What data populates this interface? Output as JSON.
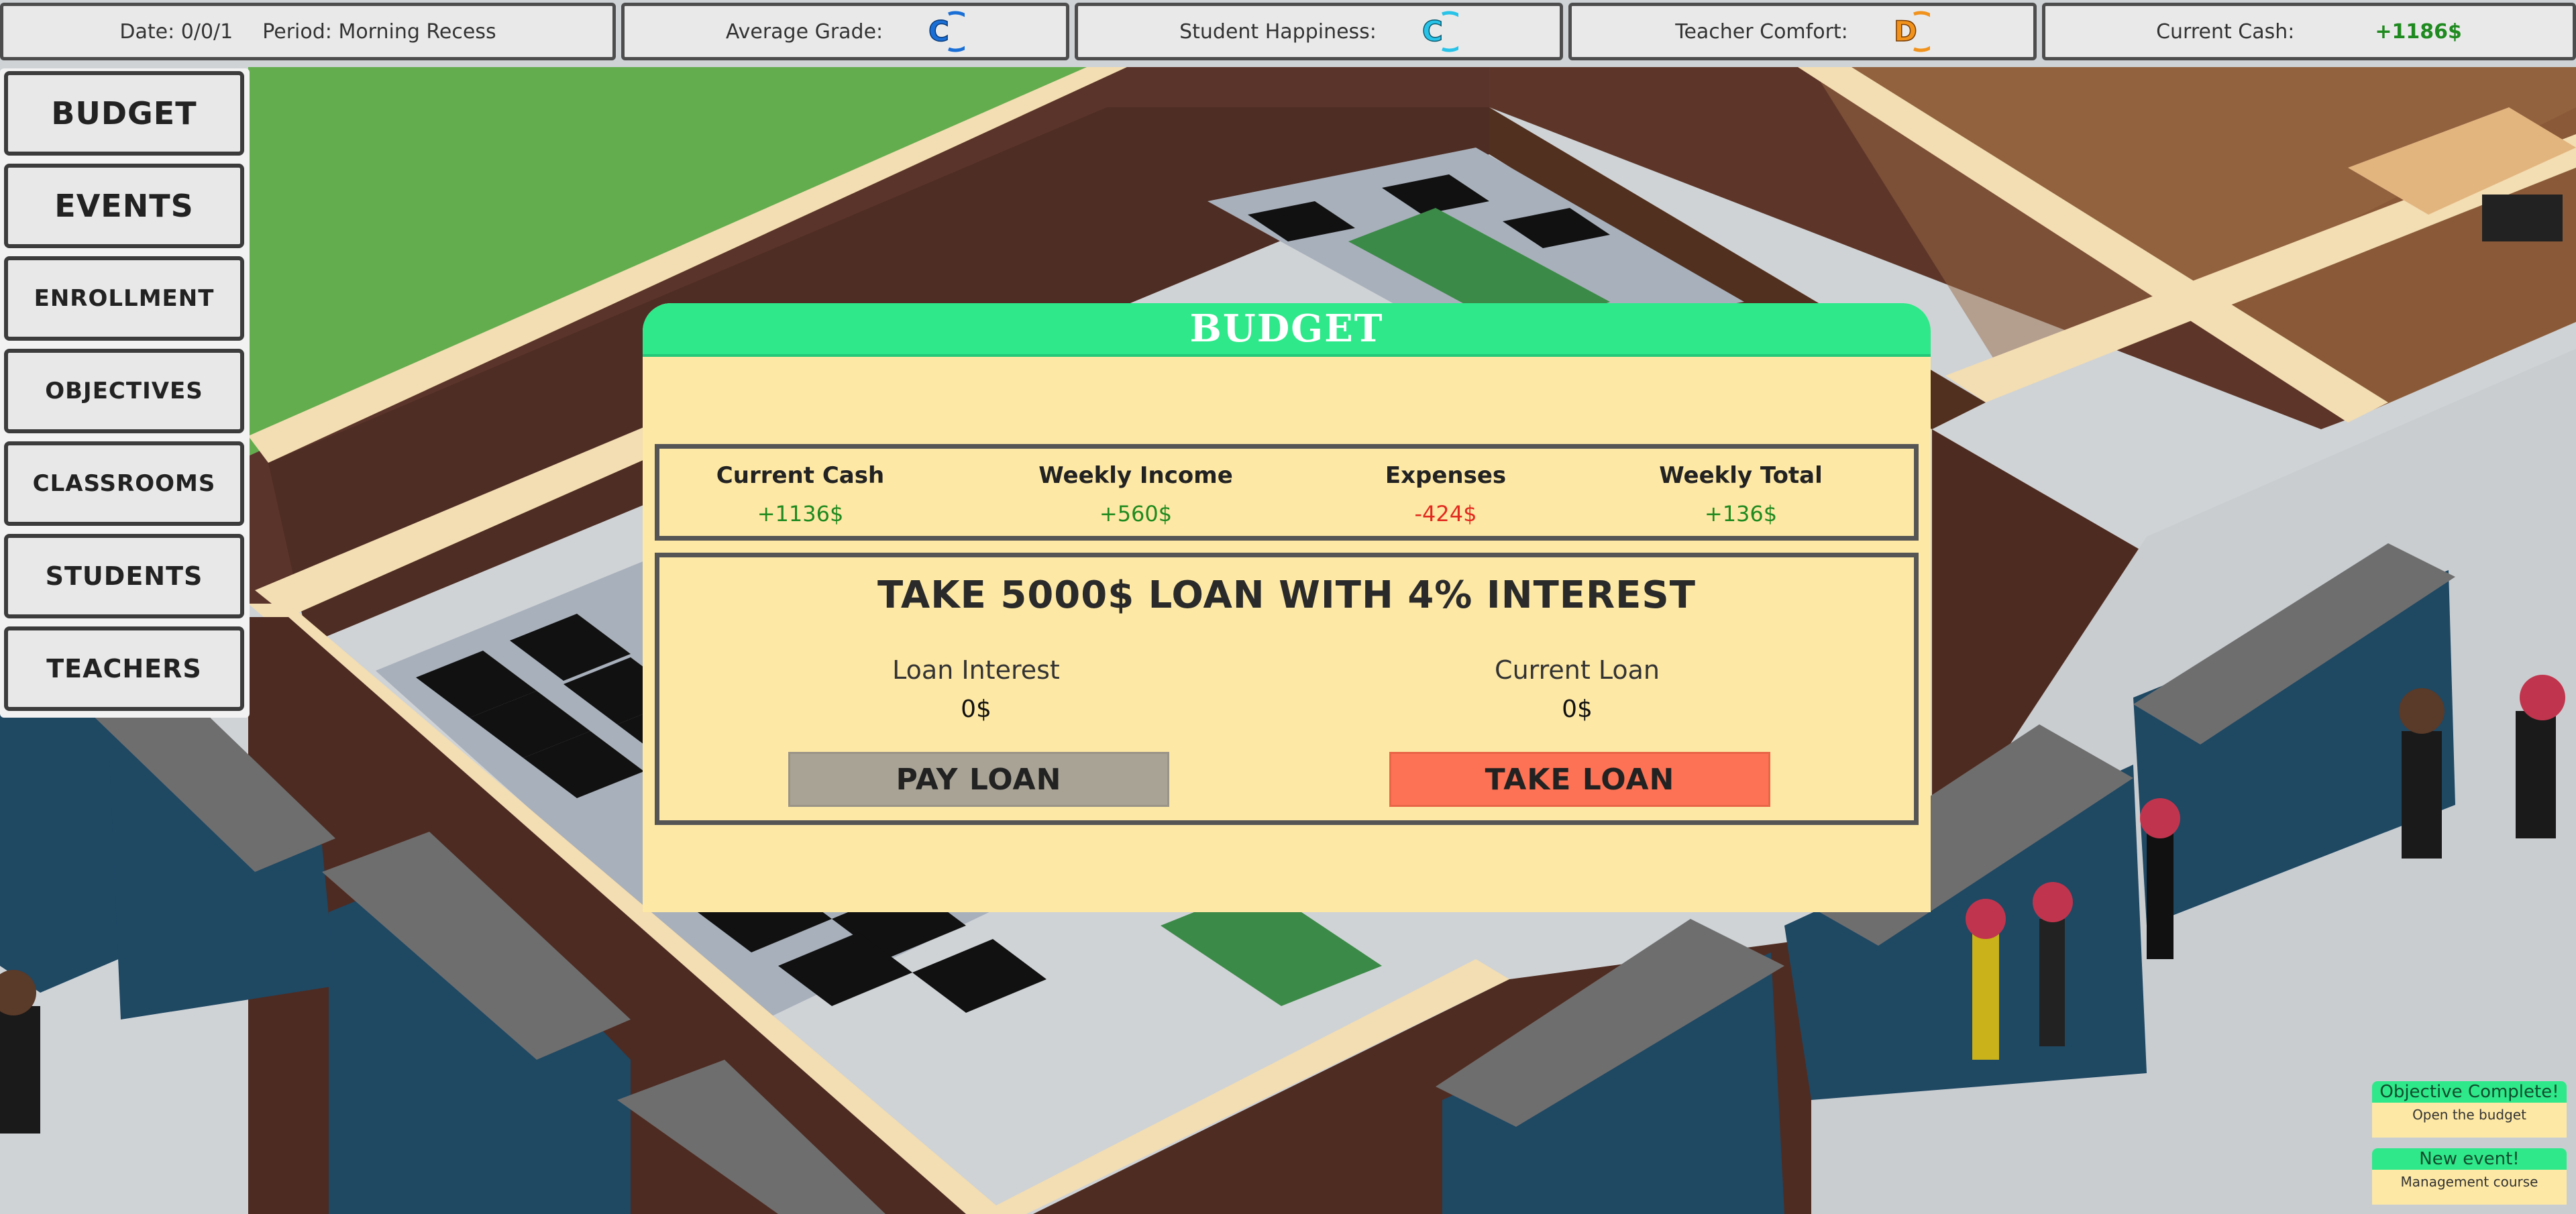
{
  "hud": {
    "date_label": "Date:",
    "date_value": "0/0/1",
    "period_label": "Period:",
    "period_value": "Morning Recess",
    "avg_grade_label": "Average Grade:",
    "avg_grade_letter": "C",
    "avg_grade_color": "#1a6fd6",
    "happiness_label": "Student Happiness:",
    "happiness_letter": "C",
    "happiness_color": "#27c3e8",
    "comfort_label": "Teacher Comfort:",
    "comfort_letter": "D",
    "comfort_color": "#f0921c",
    "cash_label": "Current Cash:",
    "cash_value": "+1186$"
  },
  "menu": {
    "items": [
      {
        "label": "BUDGET"
      },
      {
        "label": "EVENTS"
      },
      {
        "label": "ENROLLMENT"
      },
      {
        "label": "OBJECTIVES"
      },
      {
        "label": "CLASSROOMS"
      },
      {
        "label": "STUDENTS"
      },
      {
        "label": "TEACHERS"
      }
    ]
  },
  "budget": {
    "title": "BUDGET",
    "stats": [
      {
        "label": "Current Cash",
        "value": "+1136$"
      },
      {
        "label": "Weekly Income",
        "value": "+560$"
      },
      {
        "label": "Expenses",
        "value": "-424$"
      },
      {
        "label": "Weekly Total",
        "value": "+136$"
      }
    ],
    "loan_title": "TAKE 5000$ LOAN WITH 4% INTEREST",
    "loan_interest_label": "Loan Interest",
    "loan_interest_value": "0$",
    "current_loan_label": "Current Loan",
    "current_loan_value": "0$",
    "pay_button": "PAY LOAN",
    "take_button": "TAKE LOAN"
  },
  "notifications": [
    {
      "title": "Objective Complete!",
      "text": "Open the budget"
    },
    {
      "title": "New event!",
      "text": "Management course"
    }
  ],
  "colors": {
    "accent_green": "#2ee88a",
    "dialog_bg": "#fde8a5",
    "take_loan": "#fd7254",
    "pay_loan": "#a9a396"
  }
}
